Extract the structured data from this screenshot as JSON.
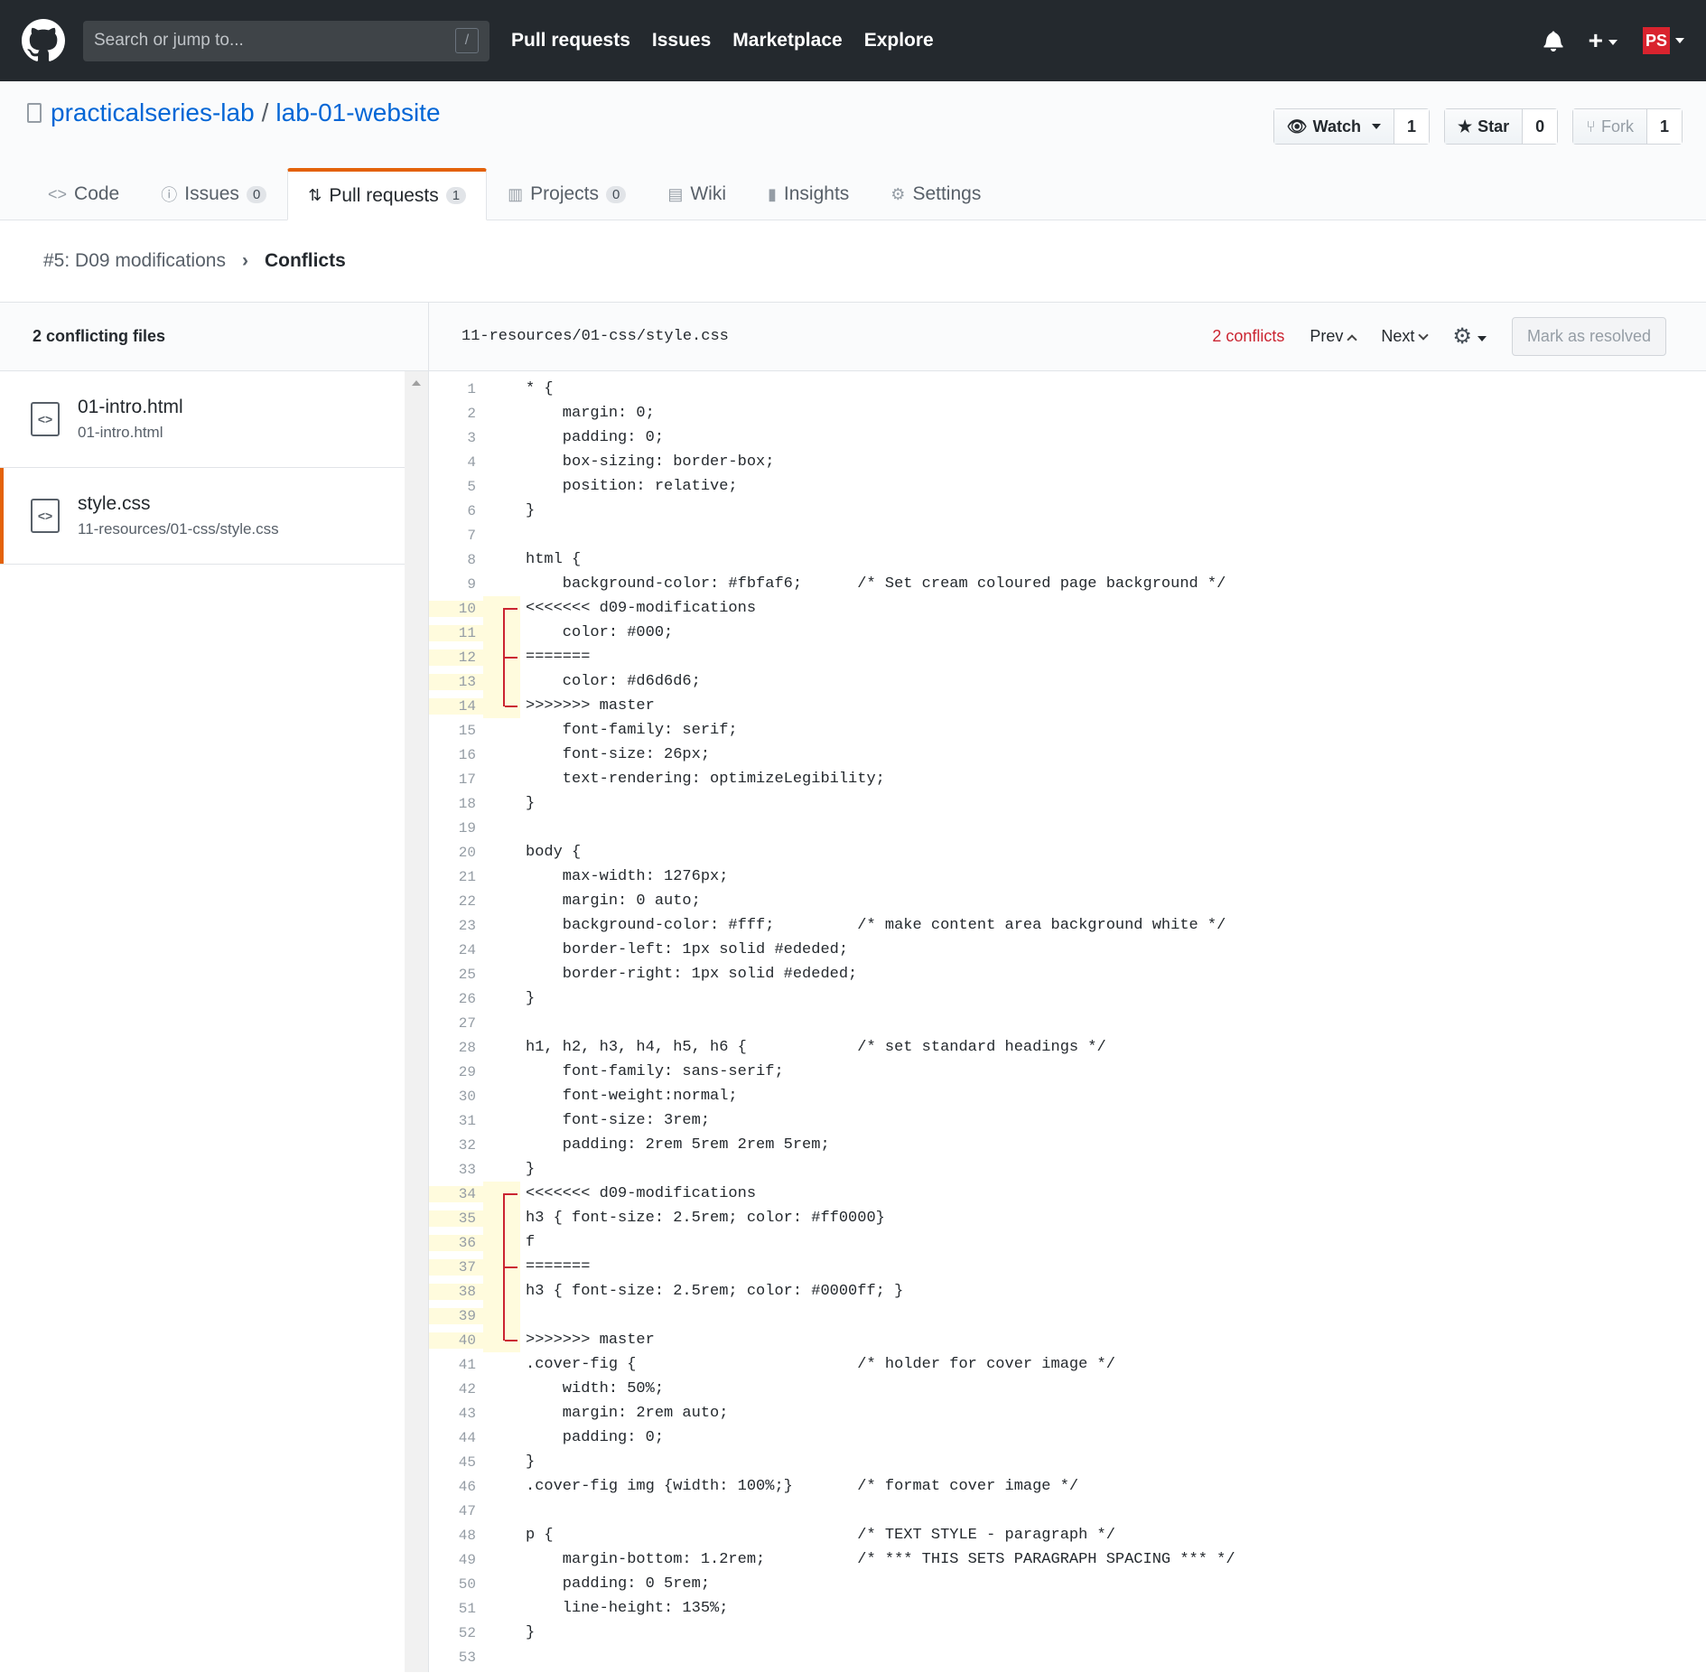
{
  "header": {
    "search_placeholder": "Search or jump to...",
    "search_key": "/",
    "nav": [
      "Pull requests",
      "Issues",
      "Marketplace",
      "Explore"
    ],
    "avatar_text": "PS"
  },
  "repo": {
    "owner": "practicalseries-lab",
    "separator": "/",
    "name": "lab-01-website",
    "watch_label": "Watch",
    "watch_count": "1",
    "star_label": "Star",
    "star_count": "0",
    "fork_label": "Fork",
    "fork_count": "1"
  },
  "tabs": {
    "code": "Code",
    "issues": "Issues",
    "issues_count": "0",
    "pulls": "Pull requests",
    "pulls_count": "1",
    "projects": "Projects",
    "projects_count": "0",
    "wiki": "Wiki",
    "insights": "Insights",
    "settings": "Settings"
  },
  "breadcrumb": {
    "pr": "#5: D09 modifications",
    "current": "Conflicts"
  },
  "sidebar": {
    "heading": "2 conflicting files",
    "files": [
      {
        "name": "01-intro.html",
        "path": "01-intro.html"
      },
      {
        "name": "style.css",
        "path": "11-resources/01-css/style.css"
      }
    ]
  },
  "editor": {
    "path": "11-resources/01-css/style.css",
    "conflicts": "2 conflicts",
    "prev": "Prev",
    "next": "Next",
    "resolve": "Mark as resolved"
  },
  "code_lines": [
    "* {",
    "    margin: 0;",
    "    padding: 0;",
    "    box-sizing: border-box;",
    "    position: relative;",
    "}",
    "",
    "html {",
    "    background-color: #fbfaf6;      /* Set cream coloured page background */",
    "<<<<<<< d09-modifications",
    "    color: #000;",
    "=======",
    "    color: #d6d6d6;",
    ">>>>>>> master",
    "    font-family: serif;",
    "    font-size: 26px;",
    "    text-rendering: optimizeLegibility;",
    "}",
    "",
    "body {",
    "    max-width: 1276px;",
    "    margin: 0 auto;",
    "    background-color: #fff;         /* make content area background white */",
    "    border-left: 1px solid #ededed;",
    "    border-right: 1px solid #ededed;",
    "}",
    "",
    "h1, h2, h3, h4, h5, h6 {            /* set standard headings */",
    "    font-family: sans-serif;",
    "    font-weight:normal;",
    "    font-size: 3rem;",
    "    padding: 2rem 5rem 2rem 5rem;",
    "}",
    "<<<<<<< d09-modifications",
    "h3 { font-size: 2.5rem; color: #ff0000}",
    "f",
    "=======",
    "h3 { font-size: 2.5rem; color: #0000ff; }",
    "",
    ">>>>>>> master",
    ".cover-fig {                        /* holder for cover image */",
    "    width: 50%;",
    "    margin: 2rem auto;",
    "    padding: 0;",
    "}",
    ".cover-fig img {width: 100%;}       /* format cover image */",
    "",
    "p {                                 /* TEXT STYLE - paragraph */",
    "    margin-bottom: 1.2rem;          /* *** THIS SETS PARAGRAPH SPACING *** */",
    "    padding: 0 5rem;",
    "    line-height: 135%;",
    "}",
    ""
  ],
  "conflict_ranges": [
    [
      10,
      14
    ],
    [
      34,
      40
    ]
  ],
  "conflict_markers": [
    10,
    12,
    14,
    34,
    37,
    40
  ]
}
